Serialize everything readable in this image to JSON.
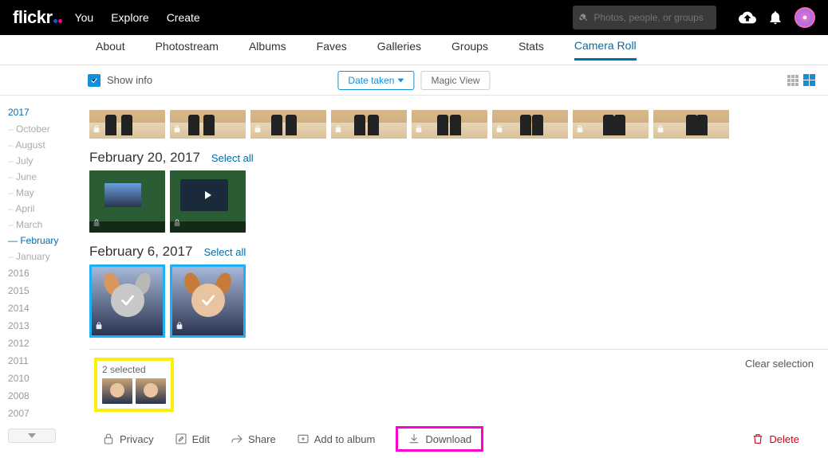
{
  "brand": "flickr",
  "topnav": {
    "you": "You",
    "explore": "Explore",
    "create": "Create"
  },
  "search": {
    "placeholder": "Photos, people, or groups"
  },
  "subnav": {
    "about": "About",
    "photostream": "Photostream",
    "albums": "Albums",
    "faves": "Faves",
    "galleries": "Galleries",
    "groups": "Groups",
    "stats": "Stats",
    "cameraroll": "Camera Roll"
  },
  "options": {
    "showinfo": "Show info",
    "datetaken": "Date taken",
    "magicview": "Magic View"
  },
  "sidebar": {
    "year_active": "2017",
    "months": [
      "October",
      "August",
      "July",
      "June",
      "May",
      "April",
      "March",
      "February",
      "January"
    ],
    "month_active_index": 7,
    "years_grey": [
      "2016",
      "2015",
      "2014",
      "2013",
      "2012",
      "2011",
      "2010",
      "2008",
      "2007"
    ]
  },
  "groups": [
    {
      "title": "February 20, 2017",
      "select_all": "Select all"
    },
    {
      "title": "February 6, 2017",
      "select_all": "Select all"
    }
  ],
  "selection": {
    "count_label": "2 selected",
    "clear": "Clear selection"
  },
  "actions": {
    "privacy": "Privacy",
    "edit": "Edit",
    "share": "Share",
    "addtoalbum": "Add to album",
    "download": "Download",
    "delete": "Delete"
  }
}
